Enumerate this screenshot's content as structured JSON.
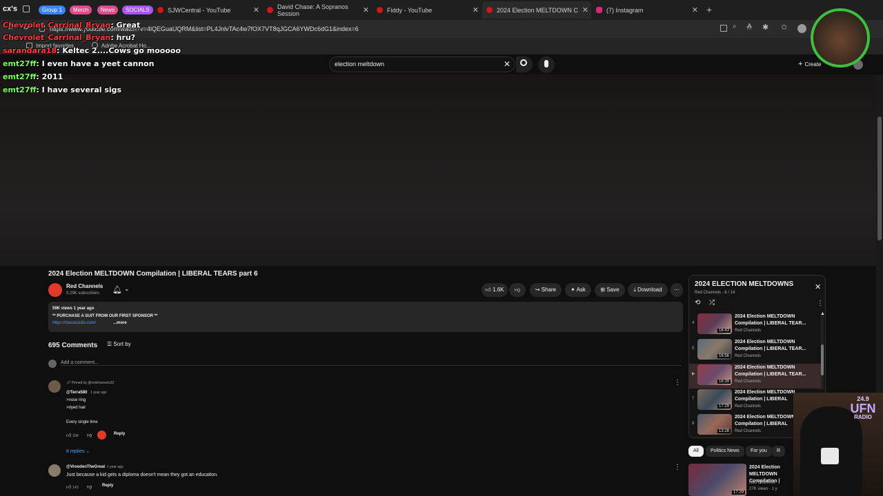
{
  "tabs": {
    "profile": "cx's",
    "groups": [
      {
        "label": "Group 1",
        "color": "#3b82f6"
      },
      {
        "label": "Merch",
        "color": "#e04b8b"
      },
      {
        "label": "News",
        "color": "#e04b8b"
      },
      {
        "label": "SOCIALS",
        "color": "#a855f7"
      }
    ],
    "items": [
      {
        "label": "SJWCentral - YouTube"
      },
      {
        "label": "David Chase: A Sopranos Session"
      },
      {
        "label": "Fiddy - YouTube"
      },
      {
        "label": "2024 Election MELTDOWN Compi"
      },
      {
        "label": "(7) Instagram"
      }
    ]
  },
  "address": {
    "url": "https://www.youtube.com/watch?v=4lQEGuaUQRM&list=PL4JnlvTAc4w7fOX7VT8qJGCA6YWDc6dG1&index=6"
  },
  "favorites": {
    "item1": "Import favorites",
    "item2": "Adobe Acrobat Ho..."
  },
  "yt": {
    "search_value": "election meltdown",
    "create_label": "Create"
  },
  "chat": [
    {
      "user": "Chevrolet_Carrinal_Bryan",
      "msg": ": Great"
    },
    {
      "user": "Chevrolet_Carrinal_Bryan",
      "msg": ": hru?"
    },
    {
      "user": "sarandara18",
      "msg": ": Keltec 2....Cows go mooooo"
    },
    {
      "user": "emt27ff",
      "msg": ": I even have a yeet cannon"
    },
    {
      "user": "emt27ff",
      "msg": ": 2011"
    },
    {
      "user": "emt27ff",
      "msg": ": I have several sigs"
    }
  ],
  "video": {
    "title": "2024 Election MELTDOWN Compilation | LIBERAL TEARS part 6",
    "channel": "Red Channels",
    "subscribers": "5.29K subscribers",
    "likes": "1.6K",
    "share": "Share",
    "ask": "Ask",
    "save": "Save",
    "download": "Download",
    "desc_meta": "59K views  1 year ago",
    "desc_line": "** PURCHASE A SUIT FROM OUR FIRST SPONSOR **",
    "desc_link": "https://classicsuits.com/",
    "desc_more": "...more"
  },
  "comments": {
    "count": "695 Comments",
    "sort": "Sort by",
    "add_placeholder": "Add a comment...",
    "items": [
      {
        "pinned": "Pinned by @redchannels22",
        "user": "@Terra580",
        "time": "1 year ago",
        "lines": [
          ">nose ring",
          ">dyed hair",
          "",
          "Every single time"
        ],
        "likes": "234",
        "reply": "Reply",
        "replies": "8 replies"
      },
      {
        "user": "@VroodenTheGreat",
        "time": "1 year ago",
        "lines": [
          "Just because a kid gets a diploma doesn't mean they got an education."
        ],
        "likes": "143",
        "reply": "Reply"
      }
    ]
  },
  "playlist": {
    "title": "2024 ELECTION MELTDOWNS",
    "sub": "Red Channels - 6 / 14",
    "items": [
      {
        "idx": "4",
        "title": "2024 Election MELTDOWN Compilation | LIBERAL TEAR...",
        "channel": "Red Channels",
        "dur": "16:43"
      },
      {
        "idx": "5",
        "title": "2024 Election MELTDOWN Compilation | LIBERAL TEAR...",
        "channel": "Red Channels",
        "dur": "16:56"
      },
      {
        "idx": "▶",
        "title": "2024 Election MELTDOWN Compilation | LIBERAL TEAR...",
        "channel": "Red Channels",
        "dur": "16:39"
      },
      {
        "idx": "7",
        "title": "2024 Election MELTDOWN Compilation | LIBERAL",
        "channel": "Red Channels",
        "dur": "17:29"
      },
      {
        "idx": "8",
        "title": "2024 Election MELTDOWN Compilation | LIBERAL",
        "channel": "Red Channels",
        "dur": "13:28"
      }
    ]
  },
  "chips": [
    "All",
    "Politics News",
    "For you",
    "R"
  ],
  "rec": {
    "title": "2024 Election MELTDOWN Compilation |",
    "channel": "Red Channels",
    "meta": "27K views - 1 y",
    "dur": "17:29"
  },
  "overlay": {
    "radio_num": "24.9",
    "radio_name": "UFN",
    "radio_sub": "RADIO"
  }
}
